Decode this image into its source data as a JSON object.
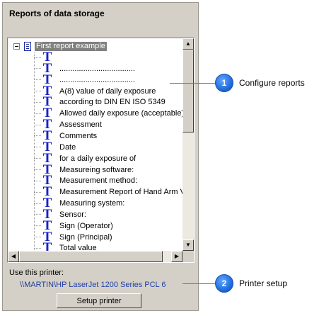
{
  "panel": {
    "title": "Reports of data storage"
  },
  "tree": {
    "root_label": "First report example",
    "items": [
      "",
      "...................................",
      "...................................",
      "A(8) value of daily exposure",
      "according to DIN EN ISO 5349",
      "Allowed daily exposure (acceptable)",
      "Assessment",
      "Comments",
      "Date",
      "for a daily exposure of",
      "Measureing software:",
      "Measurement method:",
      "Measurement Report of Hand Arm Vibra",
      "Measuring system:",
      "Sensor:",
      "Sign (Operator)",
      "Sign (Principal)",
      "Total value"
    ],
    "item_icon": "text-T-icon"
  },
  "printer": {
    "caption": "Use this printer:",
    "name": "\\\\MARTIN\\HP LaserJet 1200 Series PCL 6",
    "setup_button": "Setup printer"
  },
  "callouts": [
    {
      "number": "1",
      "label": "Configure reports"
    },
    {
      "number": "2",
      "label": "Printer setup"
    }
  ],
  "colors": {
    "badge": "#1a64d6",
    "leader": "#3a7bd5",
    "printer_name": "#2140a8",
    "t_icon": "#1a22c8"
  }
}
